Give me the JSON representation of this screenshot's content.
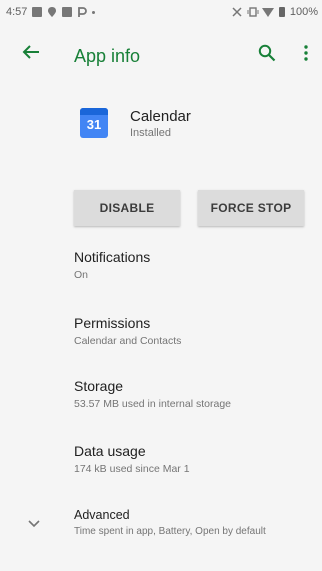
{
  "status_bar": {
    "time": "4:57",
    "battery": "100%"
  },
  "toolbar": {
    "title": "App info"
  },
  "app": {
    "name": "Calendar",
    "status": "Installed",
    "icon_label": "31"
  },
  "buttons": {
    "disable": "DISABLE",
    "force_stop": "FORCE STOP"
  },
  "prefs": {
    "notifications": {
      "title": "Notifications",
      "summary": "On"
    },
    "permissions": {
      "title": "Permissions",
      "summary": "Calendar and Contacts"
    },
    "storage": {
      "title": "Storage",
      "summary": "53.57 MB used in internal storage"
    },
    "data_usage": {
      "title": "Data usage",
      "summary": "174 kB used since Mar 1"
    },
    "advanced": {
      "title": "Advanced",
      "summary": "Time spent in app, Battery, Open by default"
    }
  },
  "colors": {
    "accent": "#188038",
    "background": "#f5f5f5",
    "button": "#dcdcdc",
    "calendar_icon": "#4285f4"
  }
}
